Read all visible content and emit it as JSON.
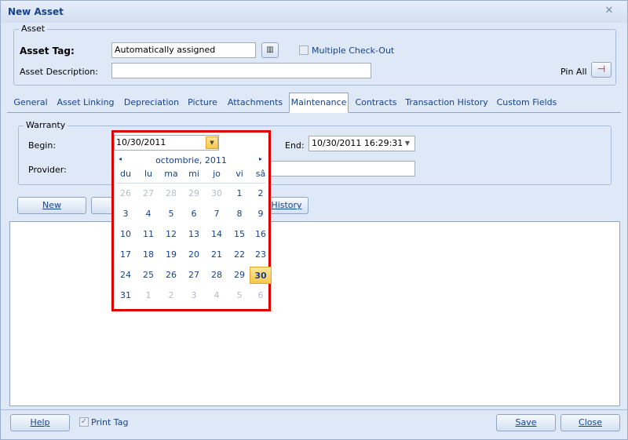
{
  "window": {
    "title": "New Asset"
  },
  "asset_group": {
    "legend": "Asset",
    "tag_label": "Asset Tag:",
    "tag_value": "Automatically assigned",
    "description_label": "Asset Description:",
    "description_value": "",
    "multiple_checkout_label": "Multiple Check-Out",
    "pin_all_label": "Pin All"
  },
  "tabs": [
    "General",
    "Asset Linking",
    "Depreciation",
    "Picture",
    "Attachments",
    "Maintenance",
    "Contracts",
    "Transaction History",
    "Custom Fields"
  ],
  "active_tab": "Maintenance",
  "warranty": {
    "legend": "Warranty",
    "begin_label": "Begin:",
    "begin_value": "10/30/2011",
    "end_label": "End:",
    "end_value": "10/30/2011 16:29:31",
    "provider_label": "Provider:",
    "provider_value": ""
  },
  "actions": {
    "new_label": "New",
    "history_label": "History"
  },
  "calendar": {
    "month_title": "octombrie, 2011",
    "prev_glyph": "◂",
    "next_glyph": "▸",
    "day_names": [
      "du",
      "lu",
      "ma",
      "mi",
      "jo",
      "vi",
      "sâ"
    ],
    "weeks": [
      [
        "26",
        "27",
        "28",
        "29",
        "30",
        "1",
        "2"
      ],
      [
        "3",
        "4",
        "5",
        "6",
        "7",
        "8",
        "9"
      ],
      [
        "10",
        "11",
        "12",
        "13",
        "14",
        "15",
        "16"
      ],
      [
        "17",
        "18",
        "19",
        "20",
        "21",
        "22",
        "23"
      ],
      [
        "24",
        "25",
        "26",
        "27",
        "28",
        "29",
        "30"
      ],
      [
        "31",
        "1",
        "2",
        "3",
        "4",
        "5",
        "6"
      ]
    ],
    "selected_day": "30"
  },
  "footer": {
    "help_label": "Help",
    "print_tag_label": "Print Tag",
    "save_label": "Save",
    "close_label": "Close"
  },
  "colors": {
    "accent": "#15428b",
    "highlight": "#e00000",
    "selected_day": "#f9c64c"
  }
}
